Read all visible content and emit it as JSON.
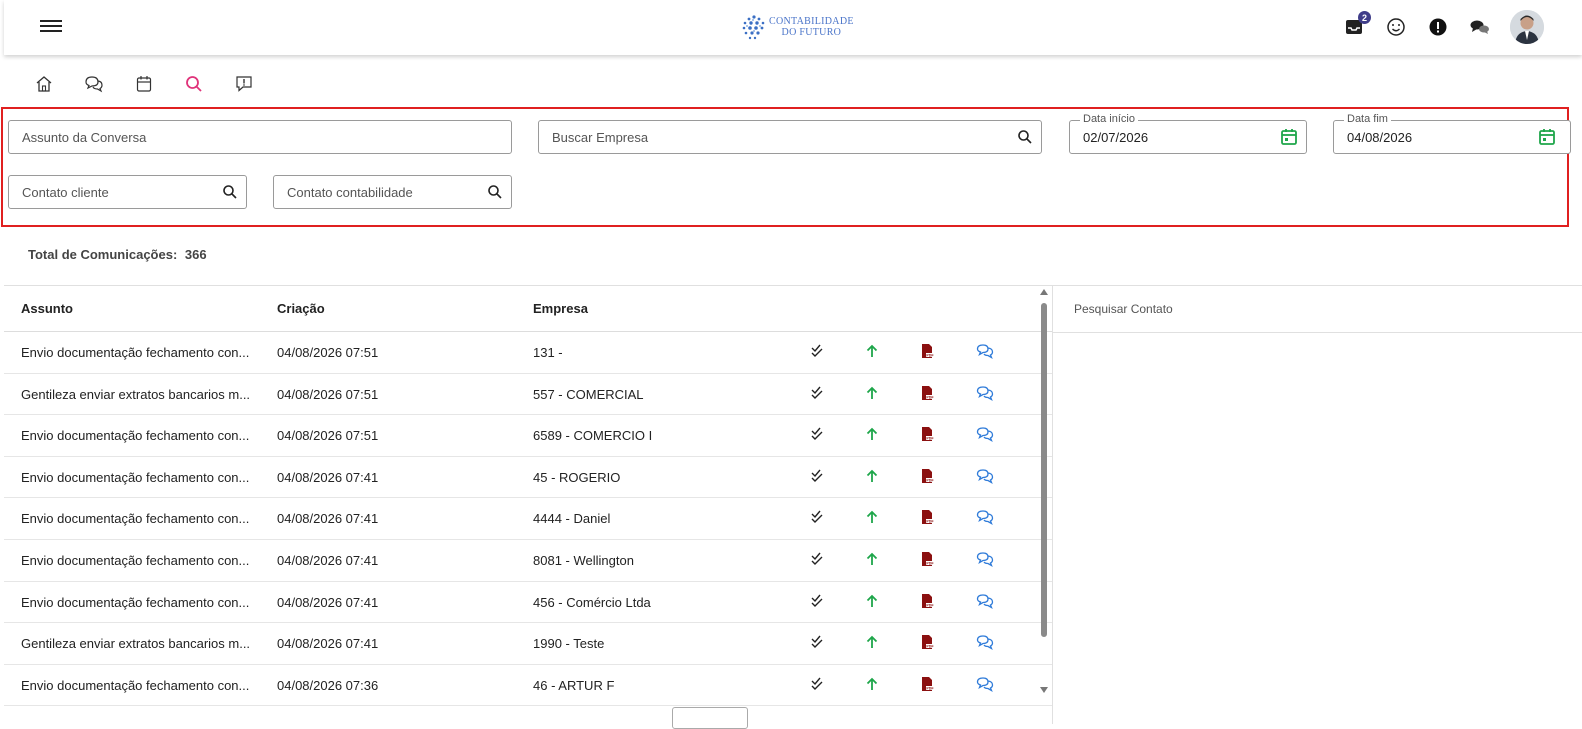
{
  "header": {
    "logo_line1": "CONTABILIDADE",
    "logo_line2": "DO FUTURO",
    "notification_count": "2"
  },
  "subnav": [
    "home-icon",
    "chats-icon",
    "calendar-icon",
    "search-icon",
    "report-icon"
  ],
  "filters": {
    "assunto_placeholder": "Assunto da Conversa",
    "empresa_placeholder": "Buscar Empresa",
    "data_inicio_label": "Data início",
    "data_inicio_value": "02/07/2026",
    "data_fim_label": "Data fim",
    "data_fim_value": "04/08/2026",
    "contato_cliente_placeholder": "Contato cliente",
    "contato_contabilidade_placeholder": "Contato contabilidade"
  },
  "summary": {
    "label": "Total de Comunicações:",
    "value": "366"
  },
  "table": {
    "columns": [
      "Assunto",
      "Criação",
      "Empresa"
    ],
    "rows": [
      {
        "assunto": "Envio documentação fechamento con...",
        "criacao": "04/08/2026 07:51",
        "empresa": "131 -"
      },
      {
        "assunto": "Gentileza enviar extratos bancarios m...",
        "criacao": "04/08/2026 07:51",
        "empresa": "557 - COMERCIAL"
      },
      {
        "assunto": "Envio documentação fechamento con...",
        "criacao": "04/08/2026 07:51",
        "empresa": "6589 - COMERCIO I"
      },
      {
        "assunto": "Envio documentação fechamento con...",
        "criacao": "04/08/2026 07:41",
        "empresa": "45 - ROGERIO"
      },
      {
        "assunto": "Envio documentação fechamento con...",
        "criacao": "04/08/2026 07:41",
        "empresa": "4444 - Daniel"
      },
      {
        "assunto": "Envio documentação fechamento con...",
        "criacao": "04/08/2026 07:41",
        "empresa": "8081 - Wellington"
      },
      {
        "assunto": "Envio documentação fechamento con...",
        "criacao": "04/08/2026 07:41",
        "empresa": "456 - Comércio Ltda"
      },
      {
        "assunto": "Gentileza enviar extratos bancarios m...",
        "criacao": "04/08/2026 07:41",
        "empresa": "1990 - Teste"
      },
      {
        "assunto": "Envio documentação fechamento con...",
        "criacao": "04/08/2026 07:36",
        "empresa": "46 - ARTUR F"
      }
    ]
  },
  "side_panel": {
    "search_placeholder": "Pesquisar Contato"
  },
  "colors": {
    "accent_pink": "#e0337a",
    "highlight_red": "#e02020",
    "green": "#1ea64a",
    "pdf_red": "#8b1010",
    "chat_blue": "#2f7bd9",
    "badge": "#3f3d89"
  }
}
